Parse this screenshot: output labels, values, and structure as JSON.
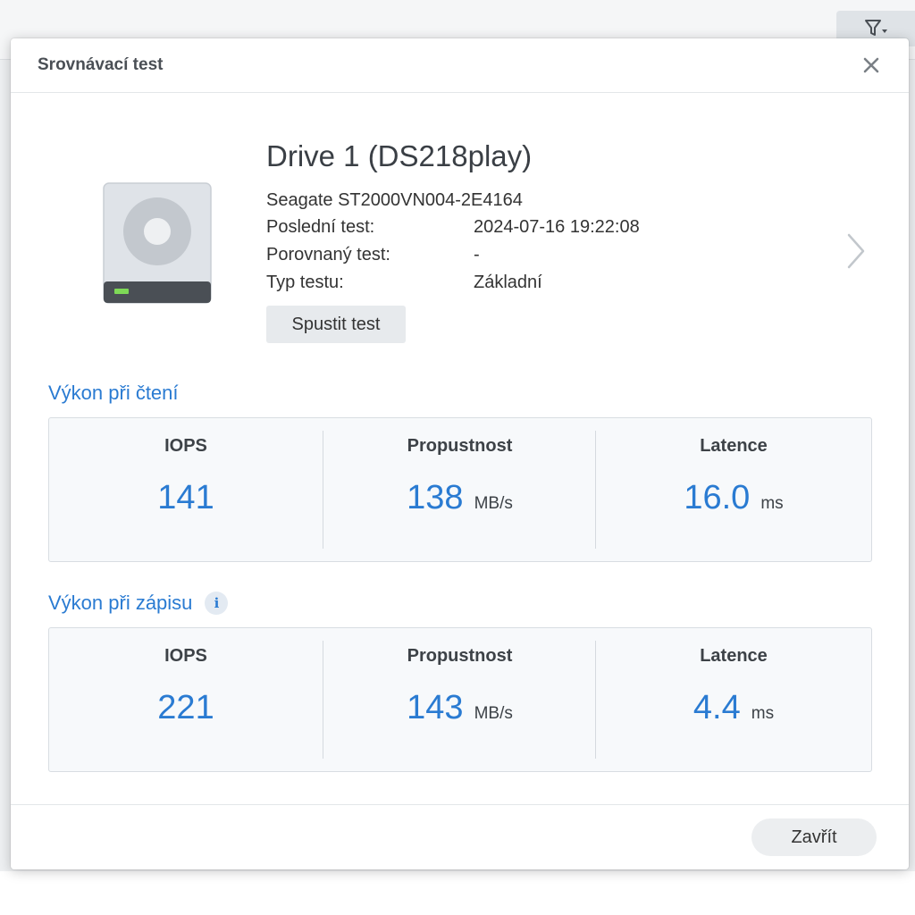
{
  "colors": {
    "accent": "#2a7bd2",
    "dialog_bg": "#ffffff",
    "metrics_bg": "#f7f9fb",
    "button_bg": "#e7eaed",
    "drive_led": "#7ed957"
  },
  "background": {
    "filter_icon": "filter-icon"
  },
  "dialog": {
    "title": "Srovnávací test",
    "close_icon": "close-icon"
  },
  "drive": {
    "icon": "hard-drive-icon",
    "name": "Drive 1 (DS218play)",
    "model": "Seagate ST2000VN004-2E4164",
    "last_test_label": "Poslední test:",
    "last_test_value": "2024-07-16 19:22:08",
    "compared_test_label": "Porovnaný test:",
    "compared_test_value": "-",
    "test_type_label": "Typ testu:",
    "test_type_value": "Základní",
    "run_button": "Spustit test",
    "next_icon": "chevron-right-icon"
  },
  "read": {
    "title": "Výkon při čtení",
    "iops_label": "IOPS",
    "iops_value": "141",
    "throughput_label": "Propustnost",
    "throughput_value": "138",
    "throughput_unit": "MB/s",
    "latency_label": "Latence",
    "latency_value": "16.0",
    "latency_unit": "ms"
  },
  "write": {
    "title": "Výkon při zápisu",
    "info_icon": "info-icon",
    "info_glyph": "i",
    "iops_label": "IOPS",
    "iops_value": "221",
    "throughput_label": "Propustnost",
    "throughput_value": "143",
    "throughput_unit": "MB/s",
    "latency_label": "Latence",
    "latency_value": "4.4",
    "latency_unit": "ms"
  },
  "footer": {
    "close_button": "Zavřít"
  }
}
